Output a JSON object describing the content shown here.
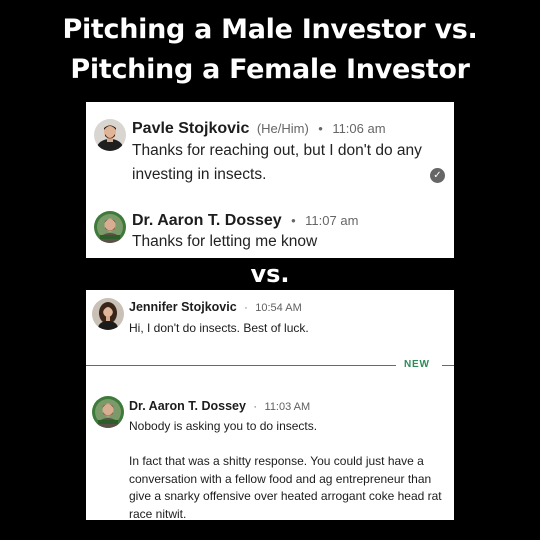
{
  "headline": {
    "line1": "Pitching a Male Investor vs.",
    "line2": "Pitching a Female Investor"
  },
  "separator": "vs.",
  "conversation_male": {
    "messages": [
      {
        "sender": "Pavle Stojkovic",
        "pronouns": "(He/Him)",
        "dot": "•",
        "time": "11:06 am",
        "text": "Thanks for reaching out, but I don't do any investing in insects.",
        "read_icon": "check-circle-icon"
      },
      {
        "sender": "Dr. Aaron T. Dossey",
        "dot": "•",
        "time": "11:07 am",
        "text": "Thanks for letting me know"
      }
    ]
  },
  "conversation_female": {
    "messages": [
      {
        "sender": "Jennifer Stojkovic",
        "dot": "·",
        "time": "10:54 AM",
        "text": "Hi, I don't do insects. Best of luck."
      },
      {
        "sender": "Dr. Aaron T. Dossey",
        "dot": "·",
        "time": "11:03 AM",
        "text": "Nobody is asking you to do insects.",
        "text2": "In fact that was a shitty response. You could just have a conversation with a fellow food and ag entrepreneur than give a snarky offensive over heated arrogant coke head rat race nitwit."
      }
    ],
    "new_divider_label": "NEW"
  },
  "colors": {
    "background": "#000000",
    "panel": "#ffffff",
    "new_divider": "#2f8a5a"
  }
}
